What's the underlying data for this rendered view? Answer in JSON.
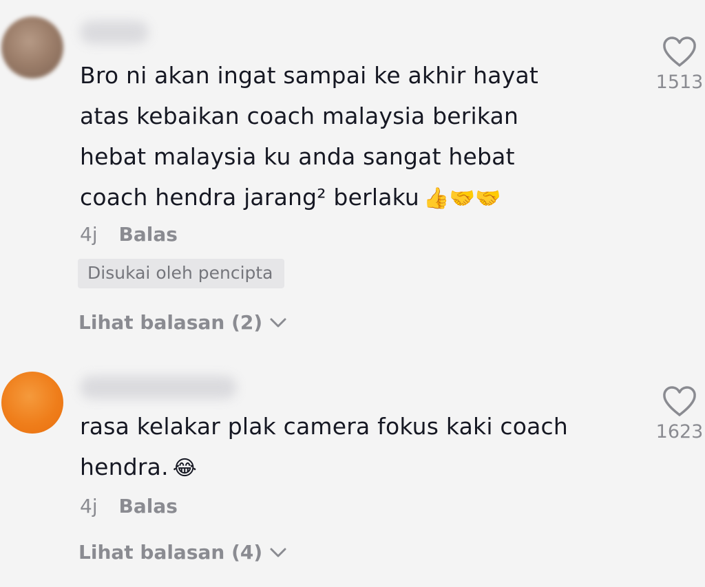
{
  "comments": [
    {
      "username": "",
      "text": "Bro ni akan ingat sampai ke akhir hayat atas kebaikan coach malaysia berikan hebat malaysia ku anda sangat hebat coach hendra jarang² berlaku",
      "emoji": "👍🤝🤝",
      "time": "4j",
      "reply_label": "Balas",
      "badge": "Disukai oleh pencipta",
      "view_replies": "Lihat balasan (2)",
      "likes": "1513",
      "icons": {
        "like": "heart-icon",
        "expand": "chevron-down-icon"
      }
    },
    {
      "username": "",
      "text": "rasa kelakar plak camera fokus kaki coach hendra.",
      "emoji": "😂",
      "time": "4j",
      "reply_label": "Balas",
      "view_replies": "Lihat balasan (4)",
      "likes": "1623",
      "icons": {
        "like": "heart-icon",
        "expand": "chevron-down-icon"
      }
    }
  ],
  "colors": {
    "background": "#f4f4f4",
    "text": "#161823",
    "muted": "#8a8b91",
    "badge_bg": "#e6e6e8",
    "avatar_2": "#ef7e1b"
  }
}
